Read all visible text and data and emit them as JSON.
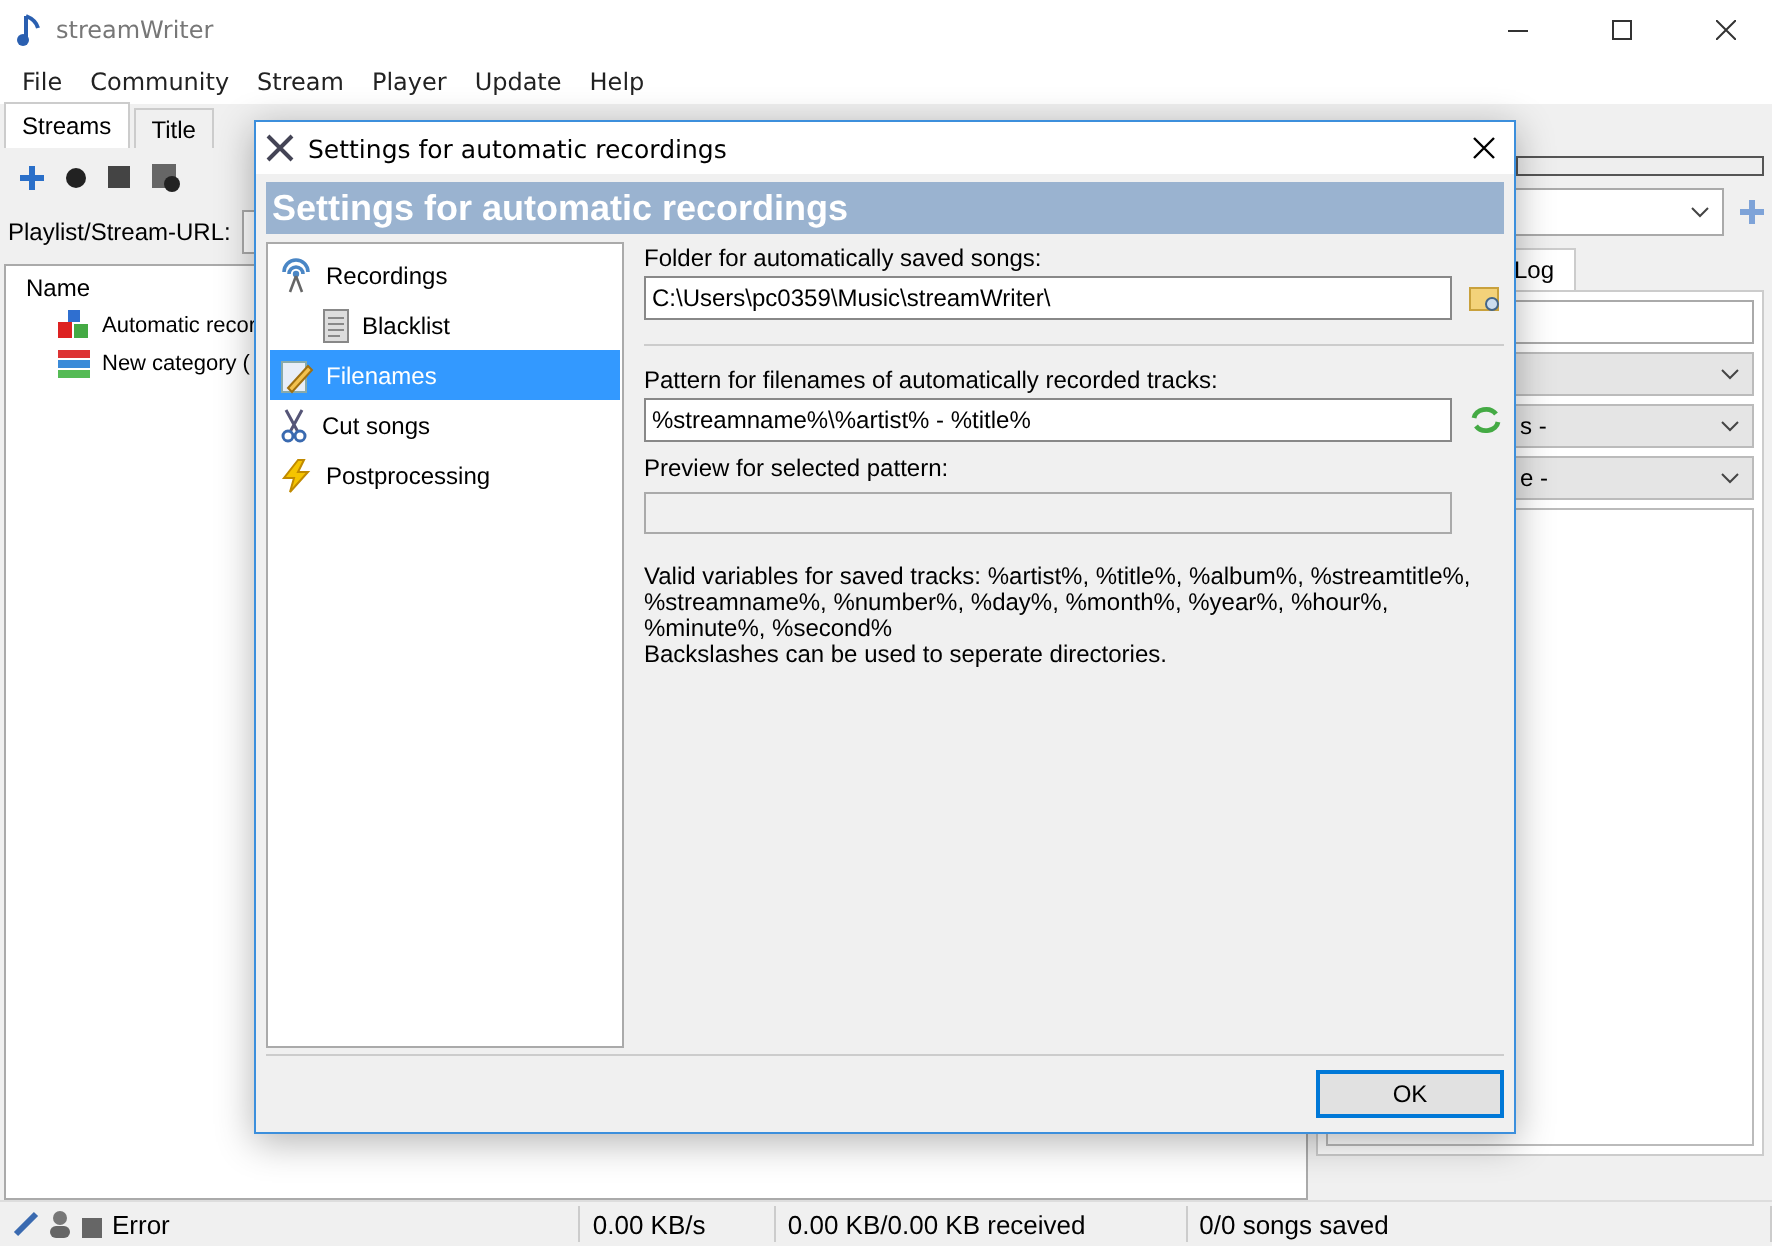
{
  "window": {
    "title": "streamWriter"
  },
  "menu": [
    "File",
    "Community",
    "Stream",
    "Player",
    "Update",
    "Help"
  ],
  "tabs": [
    {
      "label": "Streams",
      "selected": true
    },
    {
      "label": "Title",
      "selected": false
    }
  ],
  "url_row": {
    "label": "Playlist/Stream-URL:"
  },
  "tree": {
    "column": "Name",
    "items": [
      {
        "label": "Automatic recor",
        "kind": "blocks"
      },
      {
        "label": "New category (",
        "kind": "stack"
      }
    ]
  },
  "right_panel": {
    "progress": {
      "level": 0
    },
    "tab": "Log",
    "selects": [
      {
        "value": "s -"
      },
      {
        "value": "e -"
      }
    ]
  },
  "dialog": {
    "title": "Settings for automatic recordings",
    "header": "Settings for automatic recordings",
    "nav": [
      {
        "label": "Recordings",
        "kind": "antenna",
        "selected": false,
        "children": [
          {
            "label": "Blacklist",
            "kind": "document",
            "selected": false
          }
        ]
      },
      {
        "label": "Filenames",
        "kind": "pencil",
        "selected": true
      },
      {
        "label": "Cut songs",
        "kind": "scissors",
        "selected": false
      },
      {
        "label": "Postprocessing",
        "kind": "lightning",
        "selected": false
      }
    ],
    "folder": {
      "label": "Folder for automatically saved songs:",
      "value": "C:\\Users\\pc0359\\Music\\streamWriter\\"
    },
    "pattern": {
      "label": "Pattern for filenames of automatically recorded tracks:",
      "value": "%streamname%\\%artist% - %title%"
    },
    "preview": {
      "label": "Preview for selected pattern:"
    },
    "help": [
      "Valid variables for saved tracks: %artist%, %title%, %album%, %streamtitle%, %streamname%, %number%, %day%, %month%, %year%, %hour%, %minute%, %second%",
      "Backslashes can be used to seperate directories."
    ],
    "ok": "OK"
  },
  "status_bar": {
    "state": "Error",
    "speed": "0.00 KB/s",
    "received": "0.00 KB/0.00 KB received",
    "saved": "0/0 songs saved"
  }
}
